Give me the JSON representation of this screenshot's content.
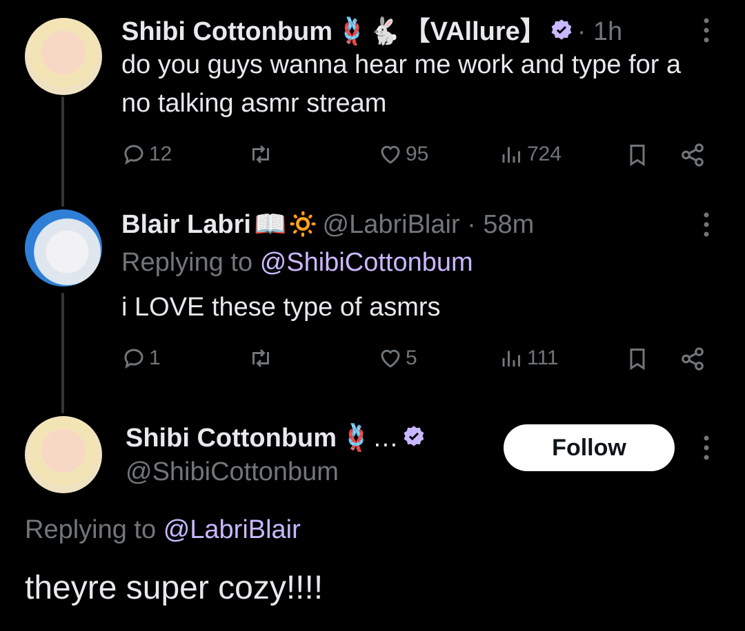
{
  "tweets": [
    {
      "name": "Shibi Cottonbum",
      "name_emojis": "🪢🐇",
      "name_suffix": "【VAllure】",
      "time": "· 1h",
      "text": "do you guys wanna hear me work and type for a no talking asmr stream",
      "stats": {
        "replies": "12",
        "retweets": "",
        "likes": "95",
        "views": "724"
      }
    },
    {
      "name": "Blair Labri",
      "name_emojis": "📖🔅",
      "handle_time": "@LabriBlair · 58m",
      "replying_to_prefix": "Replying to",
      "replying_to": "@ShibiCottonbum",
      "text": "i LOVE these type of asmrs",
      "stats": {
        "replies": "1",
        "retweets": "",
        "likes": "5",
        "views": "111"
      }
    }
  ],
  "focus_tweet": {
    "name": "Shibi Cottonbum",
    "name_emojis": "🪢…",
    "handle": "@ShibiCottonbum",
    "follow_label": "Follow",
    "replying_to_prefix": "Replying to",
    "replying_to": "@LabriBlair",
    "text": "theyre super cozy!!!!"
  },
  "colors": {
    "verified": "#c9b8ff",
    "accent_link": "#c9b8ff",
    "muted": "#71767b"
  }
}
